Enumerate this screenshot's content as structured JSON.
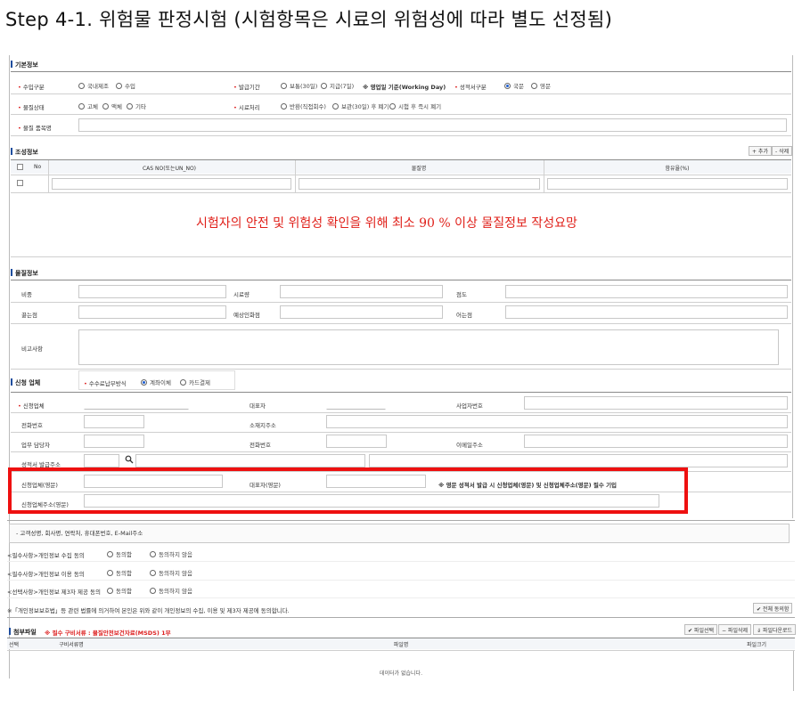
{
  "title": "Step 4-1. 위험물 판정시험 (시험항목은 시료의 위험성에 따라 별도 선정됨)",
  "basic": {
    "section": "기본정보",
    "receipt_type": {
      "label": "수입구분",
      "options": [
        "국내제조",
        "수입"
      ]
    },
    "issue_period": {
      "label": "발급기간",
      "options": [
        "보통(30일)",
        "지급(7일)"
      ],
      "note": "※ 영업일 기준(Working Day)"
    },
    "cert_type": {
      "label": "성적서구분",
      "options": [
        "국문",
        "영문"
      ]
    },
    "state": {
      "label": "물질상태",
      "options": [
        "고체",
        "액체",
        "기타"
      ]
    },
    "sample_handling": {
      "label": "시료처리",
      "options": [
        "반환(직접회수)",
        "보관(30일) 후 폐기",
        "시험 후 즉시 폐기"
      ]
    },
    "product_name": {
      "label": "물질 품목명"
    }
  },
  "composition": {
    "section": "조성정보",
    "add_label": "+ 추가",
    "delete_label": "- 삭제",
    "columns": [
      "No",
      "CAS NO(또는UN_NO)",
      "물질명",
      "함유율(%)"
    ],
    "note": "시험자의 안전 및 위험성 확인을 위해 최소 90 % 이상 물질정보 작성요망"
  },
  "physical": {
    "section": "물질정보",
    "labels": [
      "비중",
      "시료량",
      "점도",
      "끓는점",
      "예상인화점",
      "어는점"
    ],
    "remark_label": "비고사항"
  },
  "applicant": {
    "section": "신청 업체",
    "payment_label": "수수료납부방식",
    "payment_options": [
      "계좌이체",
      "카드결제"
    ],
    "company_label": "신청업체",
    "ceo_label": "대표자",
    "bizno_label": "사업자번호",
    "phone_label": "전화번호",
    "address_label": "소재지주소",
    "manager_label": "업무 담당자",
    "tel_label": "전화번호",
    "email_label": "이메일주소",
    "mail_addr_label": "성적서 발급주소",
    "company_en_label": "신청업체(영문)",
    "ceo_en_label": "대표자(영문)",
    "en_note": "※ 영문 성적서 발급 시 신청업체(영문) 및 신청업체주소(영문) 필수 기입",
    "address_en_label": "신청업체주소(영문)"
  },
  "privacy": {
    "text1": "- 고객성명, 회사명, 연락처, 휴대폰번호, E-Mail주소",
    "consents": [
      {
        "label": "<필수사항>개인정보 수집 동의",
        "options": [
          "동의함",
          "동의하지 않음"
        ]
      },
      {
        "label": "<필수사항>개인정보 이용 동의",
        "options": [
          "동의함",
          "동의하지 않음"
        ]
      },
      {
        "label": "<선택사항>개인정보 제3자 제공 동의",
        "options": [
          "동의함",
          "동의하지 않음"
        ]
      }
    ],
    "law_text": "※「개인정보보호법」등 관련 법률에 의거하여 본인은 위와 같이 개인정보의 수집, 이용 및 제3자 제공에 동의합니다.",
    "agree_all": "✔ 전체 동의함"
  },
  "attachment": {
    "section": "첨부파일",
    "required_note": "※ 필수 구비서류 : 물질안전보건자료(MSDS) 1부",
    "btn_select": "✔ 파일선택",
    "btn_delete": "− 파일삭제",
    "btn_download": "⇓ 파일다운로드",
    "columns": [
      "선택",
      "구비서류명",
      "파일명",
      "파일크기"
    ],
    "empty": "데이터가 없습니다."
  }
}
